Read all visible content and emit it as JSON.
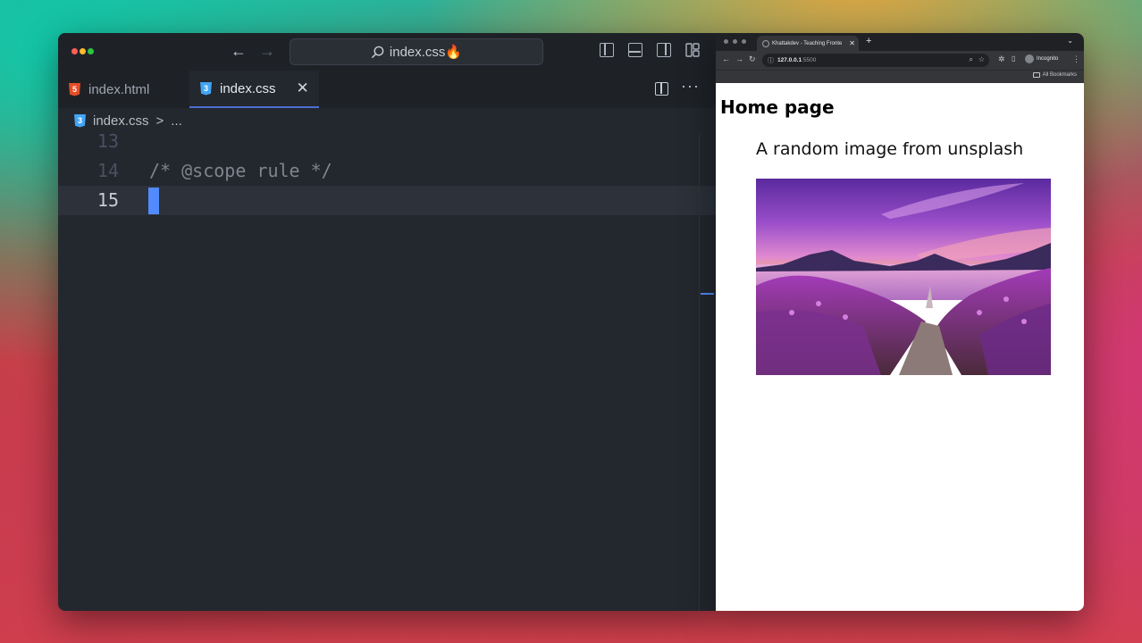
{
  "editor": {
    "search_text": "index.css🔥",
    "tabs": [
      {
        "label": "index.html",
        "badge": "5"
      },
      {
        "label": "index.css",
        "badge": "3"
      }
    ],
    "breadcrumb": {
      "file": "index.css",
      "separator": ">",
      "ellipsis": "..."
    },
    "lines": [
      {
        "number": "13",
        "code": ""
      },
      {
        "number": "14",
        "code": "/* @scope rule */"
      },
      {
        "number": "15",
        "code": ""
      }
    ]
  },
  "browser": {
    "tab_title": "Khattakdev - Teaching Fronte",
    "url": "127.0.0.1:5500",
    "url_host": "127.0.0.1",
    "url_port": ":5500",
    "profile_label": "Incognito",
    "bookmarks_label": "All Bookmarks"
  },
  "page": {
    "heading": "Home page",
    "text": "A random image from unsplash"
  },
  "colors": {
    "editor_bg": "#23272e",
    "cursor": "#528bff",
    "comment": "#7f848e"
  }
}
